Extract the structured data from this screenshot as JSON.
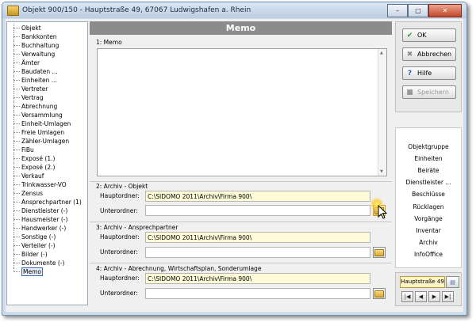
{
  "window": {
    "title": "Objekt 900/150 - Hauptstraße 49, 67067 Ludwigshafen a. Rhein",
    "minimize": "–",
    "maximize": "□",
    "close": "✕"
  },
  "nav": {
    "items": [
      "Objekt",
      "Bankkonten",
      "Buchhaltung",
      "Verwaltung",
      "Ämter",
      "Baudaten ...",
      "Einheiten ...",
      "Vertreter",
      "Vertrag",
      "Abrechnung",
      "Versammlung",
      "Einheit-Umlagen",
      "Freie Umlagen",
      "Zähler-Umlagen",
      "FiBu",
      "Exposé (1.)",
      "Exposé (2.)",
      "Verkauf",
      "Trinkwasser-VO",
      "Zensus",
      "Ansprechpartner (1)",
      "Dienstleister (-)",
      "Hausmeister (-)",
      "Handwerker (-)",
      "Sonstige (-)",
      "Verteiler (-)",
      "Bilder (-)",
      "Dokumente (-)",
      "Memo"
    ],
    "selected": "Memo"
  },
  "main": {
    "title": "Memo",
    "memo_label": "1: Memo",
    "memo_text": "",
    "sections": [
      {
        "label": "2: Archiv - Objekt",
        "haupt_label": "Hauptordner:",
        "haupt_value": "C:\\SIDOMO 2011\\Archiv\\Firma 900\\",
        "unter_label": "Unterordner:",
        "unter_value": ""
      },
      {
        "label": "3: Archiv - Ansprechpartner",
        "haupt_label": "Hauptordner:",
        "haupt_value": "C:\\SIDOMO 2011\\Archiv\\Firma 900\\",
        "unter_label": "Unterordner:",
        "unter_value": ""
      },
      {
        "label": "4: Archiv - Abrechnung, Wirtschaftsplan, Sonderumlage",
        "haupt_label": "Hauptordner:",
        "haupt_value": "C:\\SIDOMO 2011\\Archiv\\Firma 900\\",
        "unter_label": "Unterordner:",
        "unter_value": ""
      }
    ]
  },
  "actions": {
    "ok": "OK",
    "cancel": "Abbrechen",
    "help": "Hilfe",
    "save": "Speichern"
  },
  "links": [
    "Objektgruppe",
    "Einheiten",
    "Beiräte",
    "Dienstleister ...",
    "Beschlüsse",
    "Rücklagen",
    "Vorgänge",
    "Inventar",
    "Archiv",
    "InfoOffice"
  ],
  "pager": {
    "address": "Hauptstraße 49",
    "first": "|◀",
    "prev": "◀",
    "next": "▶",
    "last": "▶|"
  },
  "colors": {
    "header_bg": "#8c8c8c",
    "path_field_bg": "#fdfbd8",
    "ok_icon": "#2e9b2e",
    "cancel_icon": "#8a8a8a",
    "help_icon": "#2a5fbf"
  }
}
